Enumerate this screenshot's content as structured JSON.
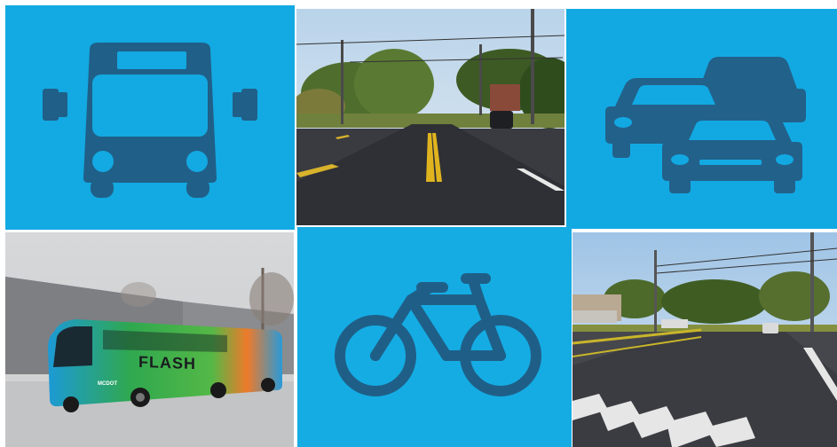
{
  "tiles": [
    {
      "icon": "bus-icon"
    },
    {
      "photo": "road-photo"
    },
    {
      "icon": "traffic-cars-icon"
    },
    {
      "photo": "flash-bus-photo",
      "bus_text": "FLASH",
      "bus_small_text": "MCDOT"
    },
    {
      "icon": "bicycle-icon"
    },
    {
      "photo": "intersection-photo"
    }
  ],
  "colors": {
    "tile_blue": "#12a8e0",
    "icon_dark": "#1f5f86"
  }
}
